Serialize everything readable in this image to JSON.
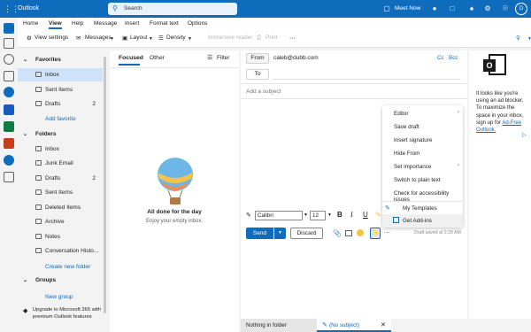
{
  "titlebar": {
    "app_name": "Outlook",
    "search_label": "Search",
    "meet_now": "Meet Now"
  },
  "tabs": [
    "Home",
    "View",
    "Help",
    "Message",
    "Insert",
    "Format text",
    "Options"
  ],
  "ribbon": {
    "view_settings": "View settings",
    "messages": "Messages",
    "layout": "Layout",
    "density": "Density",
    "immersive_reader": "Immersive reader",
    "print": "Print",
    "more": "⋯"
  },
  "folders": {
    "favorites_label": "Favorites",
    "favorites": [
      {
        "label": "Inbox",
        "count": ""
      },
      {
        "label": "Sent Items",
        "count": ""
      },
      {
        "label": "Drafts",
        "count": "2"
      }
    ],
    "add_favorite": "Add favorite",
    "folders_label": "Folders",
    "items": [
      {
        "label": "Inbox",
        "count": ""
      },
      {
        "label": "Junk Email",
        "count": ""
      },
      {
        "label": "Drafts",
        "count": "2"
      },
      {
        "label": "Sent Items",
        "count": ""
      },
      {
        "label": "Deleted Items",
        "count": ""
      },
      {
        "label": "Archive",
        "count": ""
      },
      {
        "label": "Notes",
        "count": ""
      },
      {
        "label": "Conversation Histo...",
        "count": ""
      }
    ],
    "create_folder": "Create new folder",
    "groups_label": "Groups",
    "new_group": "New group",
    "upgrade_text": "Upgrade to Microsoft 365 with premium Outlook features"
  },
  "list": {
    "tab_focused": "Focused",
    "tab_other": "Other",
    "filter": "Filter",
    "empty_title": "All done for the day",
    "empty_sub": "Enjoy your empty inbox."
  },
  "compose": {
    "from_label": "From",
    "from_value": "caleb@dubb.com",
    "to_label": "To",
    "cc": "Cc",
    "bcc": "Bcc",
    "subject_placeholder": "Add a subject",
    "font": "Calibri",
    "size": "12",
    "send": "Send",
    "discard": "Discard",
    "draft_saved": "Draft saved at 2:20 AM"
  },
  "menu": {
    "items": [
      {
        "label": "Editor",
        "arrow": "›"
      },
      {
        "label": "Save draft",
        "arrow": ""
      },
      {
        "label": "Insert signature",
        "arrow": ""
      },
      {
        "label": "Hide From",
        "arrow": ""
      },
      {
        "label": "Set importance",
        "arrow": "›"
      },
      {
        "label": "Switch to plain text",
        "arrow": ""
      },
      {
        "label": "Check for accessibility issues",
        "arrow": ""
      }
    ],
    "my_templates": "My Templates",
    "get_addins": "Get Add-ins"
  },
  "adpane": {
    "text": "It looks like you're using an ad blocker. To maximize the space in your inbox, sign up for",
    "link": "Ad-Free Outlook."
  },
  "bottom_tabs": {
    "tab1": "Nothing in folder",
    "tab2": "(No subject)"
  },
  "colors": {
    "brand": "#0f6cbd",
    "selected": "#cfe4fa"
  }
}
